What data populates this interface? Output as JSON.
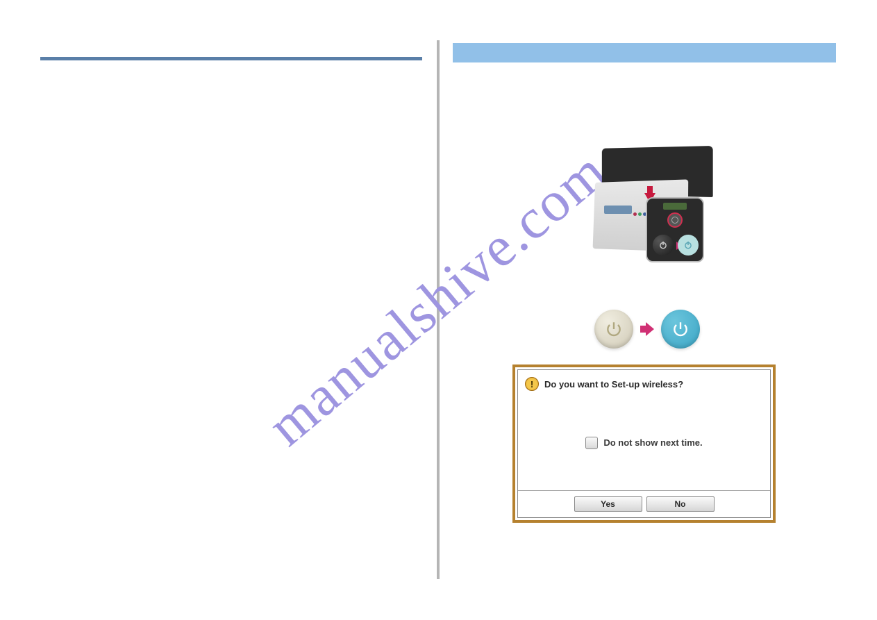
{
  "watermark_text": "manualshive.com",
  "dialog": {
    "title": "Do you want to Set-up wireless?",
    "checkbox_label": "Do not show next time.",
    "yes_label": "Yes",
    "no_label": "No"
  },
  "icons": {
    "power": "power-icon",
    "arrow_right": "arrow-right-icon",
    "arrow_down": "arrow-down-icon",
    "alert": "alert-icon"
  },
  "power_inset": {
    "label": "Power"
  }
}
